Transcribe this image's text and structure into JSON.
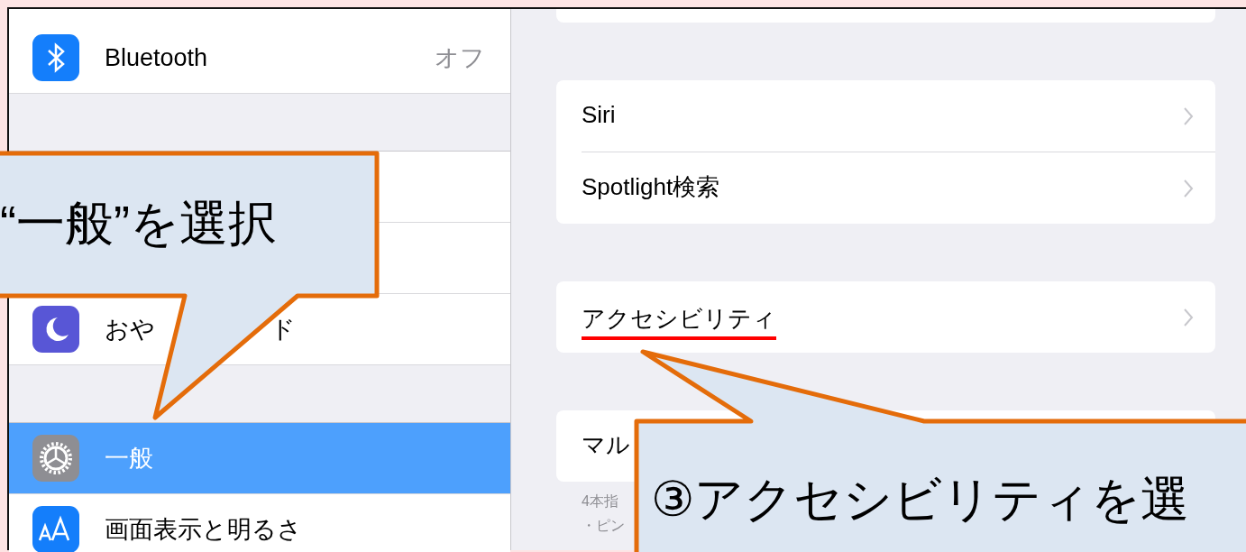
{
  "sidebar": {
    "groups": [
      {
        "items": [
          {
            "kind": "bluetooth",
            "label": "Bluetooth",
            "value": "オフ",
            "selected": false
          }
        ]
      },
      {
        "items": [
          {
            "kind": "covered",
            "selected": false
          },
          {
            "kind": "covered",
            "selected": false
          },
          {
            "kind": "moon",
            "label_parts": [
              "おや",
              "ド"
            ],
            "selected": false
          }
        ]
      },
      {
        "items": [
          {
            "kind": "gear",
            "label": "一般",
            "selected": true
          },
          {
            "kind": "display",
            "label": "画面表示と明るさ",
            "selected": false
          }
        ]
      }
    ]
  },
  "detail": {
    "groups": [
      {
        "rows": [
          {
            "label": "Siri",
            "underlined": false
          },
          {
            "label": "Spotlight検索",
            "underlined": false
          }
        ]
      },
      {
        "rows": [
          {
            "label": "アクセシビリティ",
            "underlined": true
          }
        ]
      },
      {
        "rows": [
          {
            "label": "マル",
            "underlined": false
          }
        ],
        "footer": [
          "4本指",
          "・ピン"
        ]
      }
    ]
  },
  "callouts": [
    {
      "kind": "left",
      "text": "“一般”を選択"
    },
    {
      "kind": "bottom",
      "text": "③アクセシビリティを選"
    }
  ]
}
